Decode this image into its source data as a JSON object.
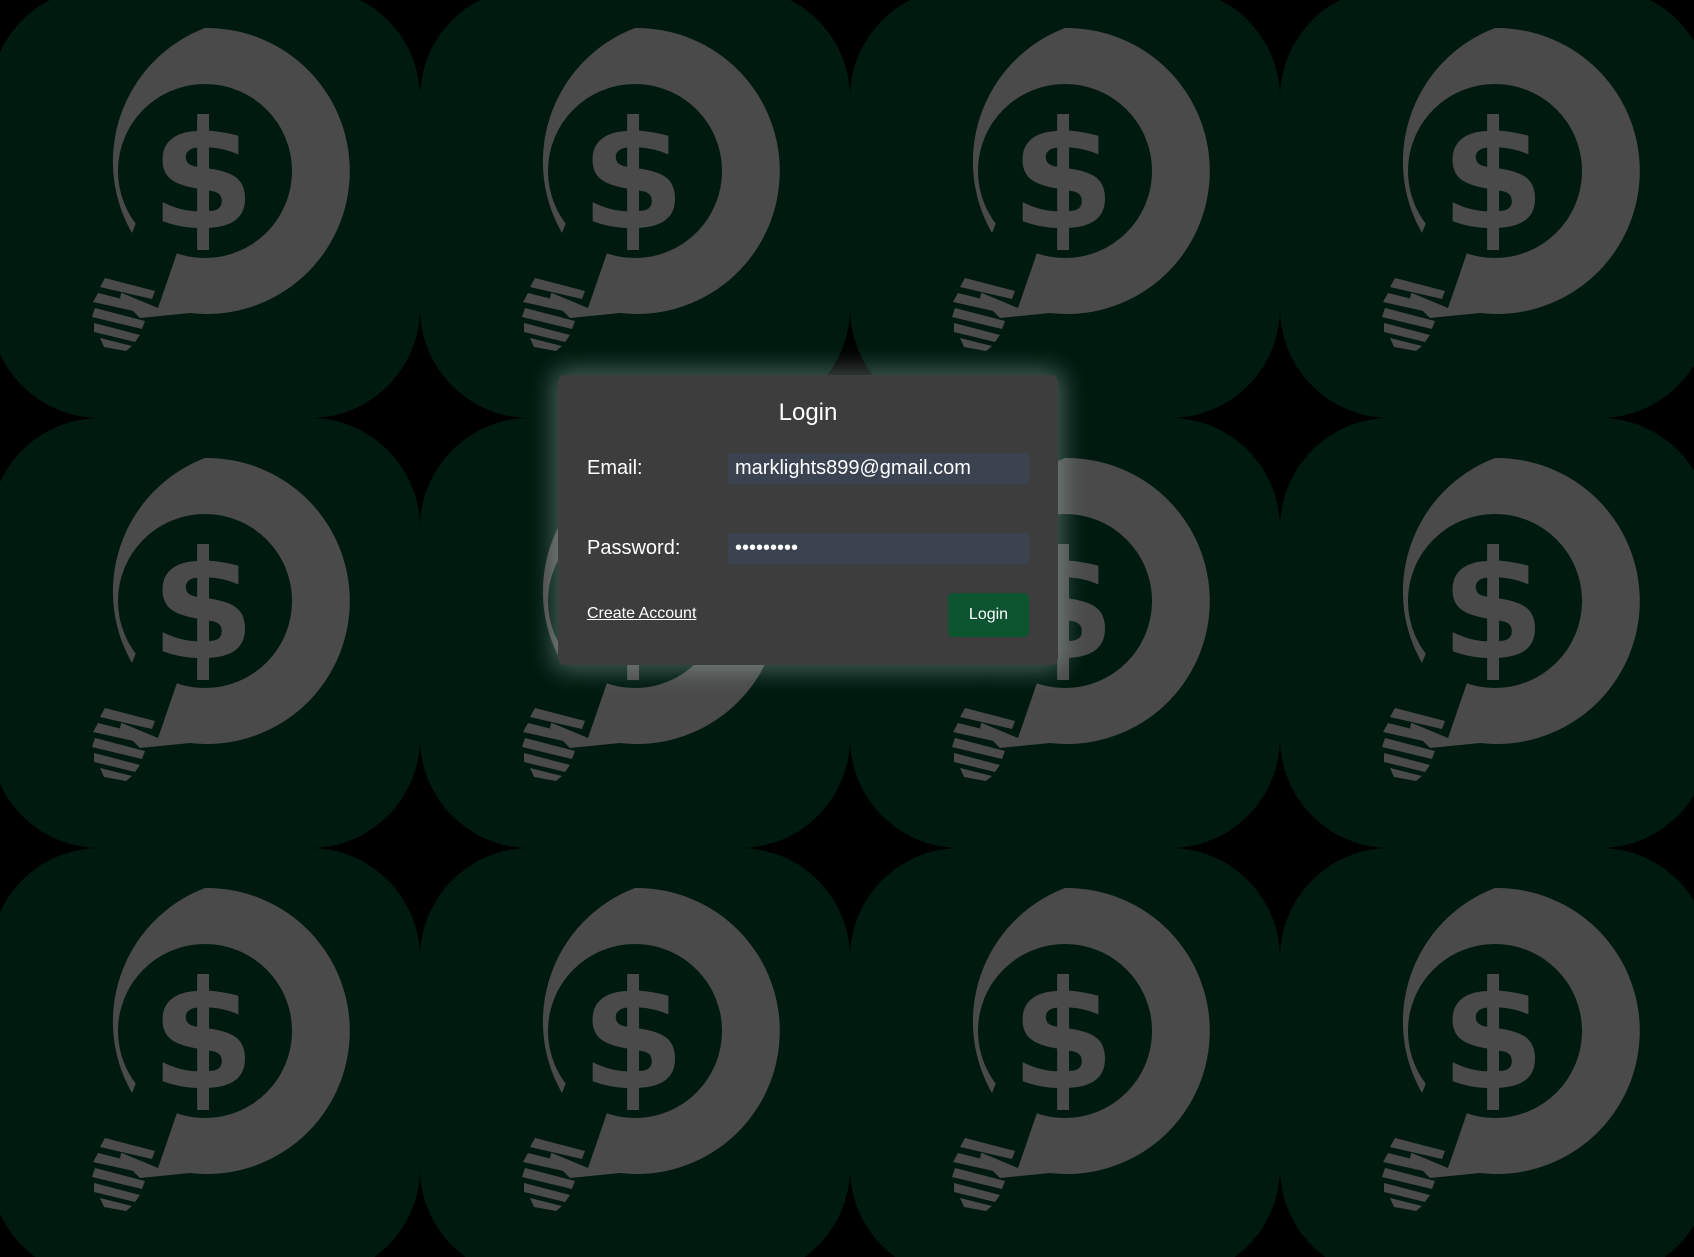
{
  "background": {
    "tile_icon": "lightbulb-dollar-icon",
    "tile_color": "#001a10",
    "icon_color": "#4a4a4a"
  },
  "login": {
    "title": "Login",
    "email_label": "Email:",
    "email_value": "marklights899@gmail.com",
    "password_label": "Password:",
    "password_value": "•••••••••",
    "create_account_label": "Create Account",
    "login_button_label": "Login"
  },
  "colors": {
    "card_bg": "#3d3d3d",
    "input_bg": "#3b4351",
    "button_bg": "#0c5530"
  }
}
